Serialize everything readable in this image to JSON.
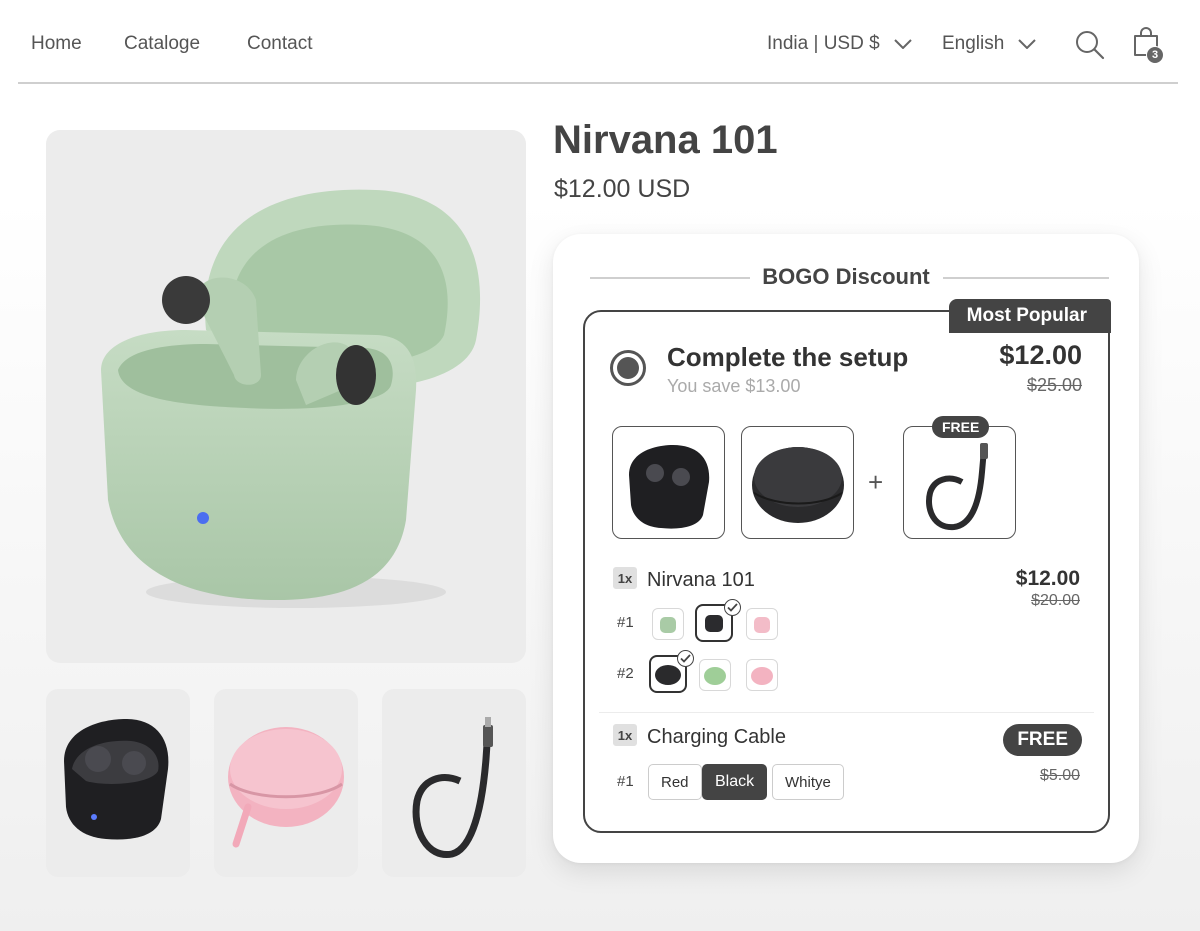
{
  "nav": {
    "links": [
      "Home",
      "Cataloge",
      "Contact"
    ],
    "region": "India | USD $",
    "language": "English",
    "cart_count": "3",
    "icons": {
      "search": "search-icon",
      "cart": "shopping-bag-icon",
      "chevron": "chevron-down-icon"
    }
  },
  "product": {
    "title": "Nirvana 101",
    "price": "$12.00 USD"
  },
  "bogo": {
    "heading": "BOGO Discount",
    "offer": {
      "badge": "Most Popular",
      "name": "Complete the setup",
      "savings": "You save $13.00",
      "price": "$12.00",
      "original_price": "$25.00",
      "free_label": "FREE",
      "plus": "+"
    },
    "lines": [
      {
        "qty": "1x",
        "name": "Nirvana 101",
        "price": "$12.00",
        "original_price": "$20.00",
        "variants": [
          {
            "label": "#1",
            "colors": [
              "green",
              "black",
              "pink"
            ],
            "selected": "black"
          },
          {
            "label": "#2",
            "colors": [
              "black",
              "green",
              "pink"
            ],
            "selected": "black"
          }
        ]
      },
      {
        "qty": "1x",
        "name": "Charging Cable",
        "price": "FREE",
        "original_price": "$5.00",
        "variants": [
          {
            "label": "#1",
            "options": [
              "Red",
              "Black",
              "Whitye"
            ],
            "selected": "Black"
          }
        ]
      }
    ]
  },
  "colors": {
    "accent": "#444444",
    "earbuds_green": "#b9d3b8",
    "case_pink": "#f2b7c4",
    "case_black": "#2b2b2e"
  }
}
